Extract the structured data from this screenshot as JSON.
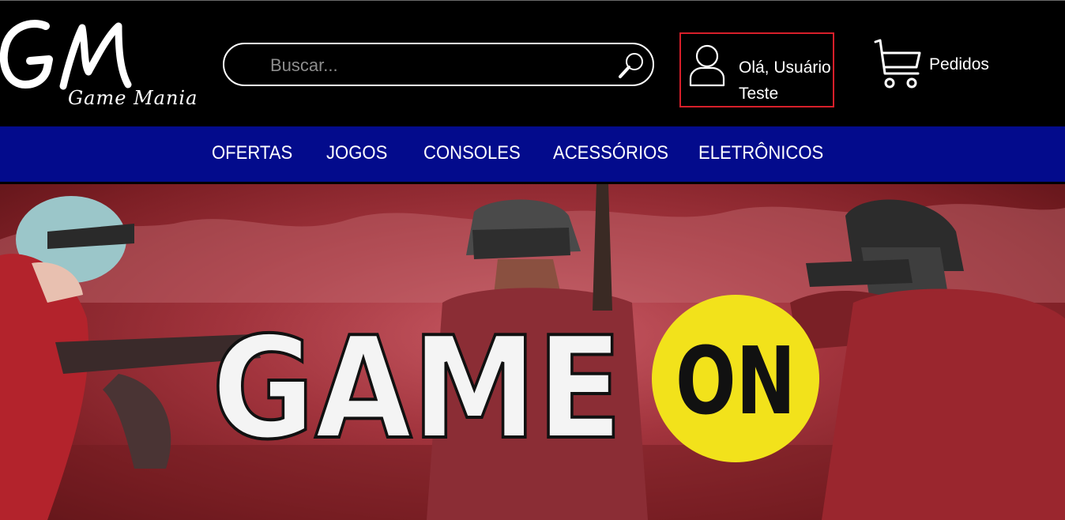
{
  "brand": {
    "logo_text": "GM",
    "logo_subtitle": "Game Mania"
  },
  "search": {
    "placeholder": "Buscar...",
    "value": ""
  },
  "account": {
    "greeting_line1": "Olá, Usuário",
    "greeting_line2": "Teste",
    "highlight_color": "#d71f2a",
    "icon": "user-icon"
  },
  "cart": {
    "label": "Pedidos",
    "icon": "cart-icon"
  },
  "nav": {
    "background": "#030b8c",
    "items": [
      {
        "label": "OFERTAS"
      },
      {
        "label": "JOGOS"
      },
      {
        "label": "CONSOLES"
      },
      {
        "label": "ACESSÓRIOS"
      },
      {
        "label": "ELETRÔNICOS"
      }
    ]
  },
  "banner": {
    "title_word": "GAME",
    "badge_word": "ON",
    "badge_color": "#f2e21b",
    "theme_color": "#a2343d"
  }
}
